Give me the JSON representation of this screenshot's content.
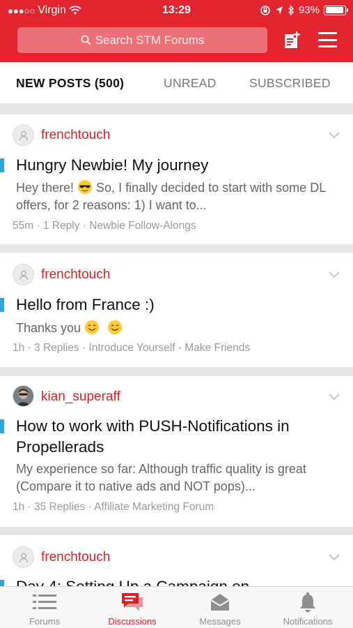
{
  "status_bar": {
    "signal_dots": "●●●○○",
    "carrier": "Virgin",
    "time": "13:29",
    "battery": "93%",
    "battery_level": 0.93
  },
  "header": {
    "search_placeholder": "Search STM Forums",
    "accent_color": "#e1242e"
  },
  "tabs": [
    {
      "label": "NEW POSTS (500)",
      "active": true
    },
    {
      "label": "UNREAD",
      "active": false
    },
    {
      "label": "SUBSCRIBED",
      "active": false
    }
  ],
  "posts": [
    {
      "author": "frenchtouch",
      "avatar": "default-user-icon",
      "title": "Hungry Newbie! My journey",
      "excerpt_a": "Hey there! ",
      "excerpt_emoji": "sunglasses-emoji",
      "excerpt_b": " So, I finally decided to start with some DL offers, for 2 reasons: 1) I want to...",
      "meta": "55m · 1 Reply · Newbie Follow-Alongs"
    },
    {
      "author": "frenchtouch",
      "avatar": "default-user-icon",
      "title": "Hello from France :)",
      "excerpt_a": "Thanks you ",
      "excerpt_emoji": "smile-emoji",
      "meta": "1h · 3 Replies · Introduce Yourself - Make Friends"
    },
    {
      "author": "kian_superaff",
      "avatar": "user-photo",
      "title": "How to work with PUSH-Notifications in Propellerads",
      "excerpt": "My experience so far: Although traffic quality is great (Compare it to native ads and NOT pops)...",
      "meta": "1h · 35 Replies · Affiliate Marketing Forum"
    },
    {
      "author": "frenchtouch",
      "avatar": "default-user-icon",
      "title": "Day 4: Setting Up a Campaign on"
    }
  ],
  "bottom_nav": [
    {
      "label": "Forums",
      "icon": "list-icon",
      "active": false
    },
    {
      "label": "Discussions",
      "icon": "chat-bubbles-icon",
      "active": true
    },
    {
      "label": "Messages",
      "icon": "envelope-icon",
      "active": false
    },
    {
      "label": "Notifications",
      "icon": "bell-icon",
      "active": false
    }
  ]
}
